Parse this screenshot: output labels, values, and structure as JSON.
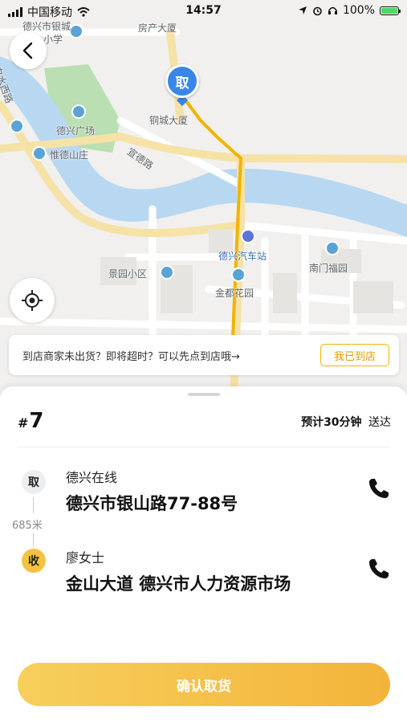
{
  "status_bar": {
    "carrier": "中国移动",
    "time": "14:57",
    "battery": "100%"
  },
  "map": {
    "labels": {
      "city_bank": "德兴市银城",
      "school_suffix": "小学",
      "realestate": "房产大厦",
      "baishui_road": "白水西路",
      "dexing_square": "德兴广场",
      "tongcheng": "铜城大厦",
      "weide": "惟德山庄",
      "xuande_road": "宣德路",
      "bus_station": "德兴汽车站",
      "nanmen": "南门福园",
      "jingyuan": "景园小区",
      "jindu": "金都花园"
    },
    "pickup_marker": "取"
  },
  "notice": {
    "text": "到店商家未出货？即将超时？可以先点到店哦→",
    "button": "我已到店"
  },
  "order": {
    "number": "7",
    "hash": "#",
    "eta_prefix": "预计",
    "eta_time": "30分钟",
    "eta_suffix": "送达"
  },
  "pickup": {
    "badge": "取",
    "name": "德兴在线",
    "address": "德兴市银山路77-88号"
  },
  "distance": "685米",
  "dropoff": {
    "badge": "收",
    "name": "廖女士",
    "address": "金山大道 德兴市人力资源市场"
  },
  "confirm_button": "确认取货",
  "colors": {
    "accent": "#f3b43a",
    "pin_blue": "#3a86e8",
    "route": "#f0b400",
    "river": "#b8d8f2"
  }
}
